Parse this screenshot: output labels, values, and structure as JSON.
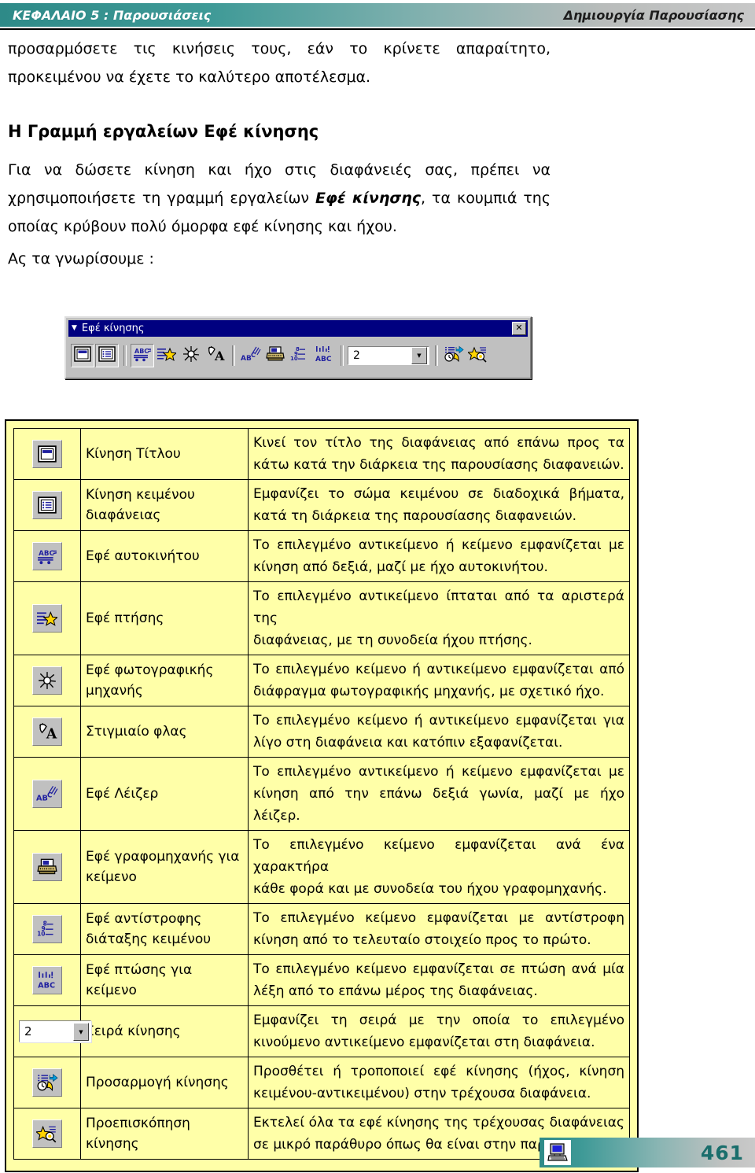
{
  "header": {
    "chapter": "ΚΕΦΑΛΑΙΟ 5 :  Παρουσιάσεις",
    "section": "Δημιουργία Παρουσίασης"
  },
  "content": {
    "intro_paragraph": "προσαρμόσετε τις κινήσεις τους, εάν το κρίνετε απαραίτητο, προκειμένου να έχετε το καλύτερο αποτέλεσμα.",
    "section_heading": "Η Γραμμή εργαλείων Εφέ κίνησης",
    "body_part1": "Για να δώσετε κίνηση και ήχο στις διαφάνειές σας, πρέπει να χρησιμοποιήσετε τη γραμμή εργαλείων ",
    "body_emphasis": "Εφέ κίνησης",
    "body_part2": ", τα κουμπιά της οποίας κρύβουν πολύ όμορφα εφέ κίνησης και ήχου.",
    "lets_know": "Ας τα γνωρίσουμε :"
  },
  "toolbar": {
    "title": "Εφέ κίνησης",
    "close_label": "✕",
    "drop_arrow": "▼",
    "order_value": "2",
    "buttons": [
      {
        "name": "animate-title-button",
        "icon": "window-title-icon"
      },
      {
        "name": "animate-slide-text-button",
        "icon": "window-list-icon"
      },
      {
        "name": "drive-in-effect-button",
        "icon": "abc-car-icon"
      },
      {
        "name": "flying-effect-button",
        "icon": "lines-star-icon"
      },
      {
        "name": "camera-effect-button",
        "icon": "camera-burst-icon"
      },
      {
        "name": "flash-once-button",
        "icon": "flash-a-icon"
      },
      {
        "name": "laser-text-effect-button",
        "icon": "ab-laser-icon"
      },
      {
        "name": "typewriter-text-effect-button",
        "icon": "typewriter-icon"
      },
      {
        "name": "reverse-text-order-effect-button",
        "icon": "numbers-reverse-icon"
      },
      {
        "name": "drop-in-text-effect-button",
        "icon": "abc-drop-icon"
      },
      {
        "name": "animation-order-combo",
        "icon": "combo-box"
      },
      {
        "name": "custom-animation-button",
        "icon": "custom-animation-icon"
      },
      {
        "name": "animation-preview-button",
        "icon": "star-preview-icon"
      }
    ]
  },
  "table": {
    "rows": [
      {
        "icon": "window-title-icon",
        "name": "Κίνηση Τίτλου",
        "desc_lines": [
          "Κινεί τον τίτλο της διαφάνειας από επάνω προς τα",
          "κάτω κατά την διάρκεια της παρουσίασης διαφανειών."
        ]
      },
      {
        "icon": "window-list-icon",
        "name": "Κίνηση κειμένου διαφάνειας",
        "desc_lines": [
          "Εμφανίζει το σώμα κειμένου σε διαδοχικά βήματα,",
          "κατά τη διάρκεια της παρουσίασης διαφανειών."
        ]
      },
      {
        "icon": "abc-car-icon",
        "name": "Εφέ αυτοκινήτου",
        "desc_lines": [
          "Το επιλεγμένο αντικείμενο ή κείμενο εμφανίζεται με",
          "κίνηση από δεξιά, μαζί με ήχο αυτοκινήτου."
        ]
      },
      {
        "icon": "lines-star-icon",
        "name": "Εφέ πτήσης",
        "desc_lines": [
          "Το επιλεγμένο αντικείμενο ίπταται από τα αριστερά της",
          "διαφάνειας, με τη συνοδεία ήχου πτήσης."
        ]
      },
      {
        "icon": "camera-burst-icon",
        "name": "Εφέ φωτογραφικής μηχανής",
        "desc_lines": [
          "Το επιλεγμένο κείμενο ή αντικείμενο εμφανίζεται από",
          "διάφραγμα φωτογραφικής μηχανής, με σχετικό ήχο."
        ]
      },
      {
        "icon": "flash-a-icon",
        "name": "Στιγμιαίο φλας",
        "desc_lines": [
          "Το επιλεγμένο κείμενο ή αντικείμενο εμφανίζεται για",
          "λίγο στη διαφάνεια και κατόπιν εξαφανίζεται."
        ]
      },
      {
        "icon": "ab-laser-icon",
        "name": "Εφέ Λέιζερ",
        "desc_lines": [
          "Το επιλεγμένο αντικείμενο ή κείμενο εμφανίζεται με",
          "κίνηση από την επάνω δεξιά γωνία, μαζί με ήχο λέιζερ."
        ]
      },
      {
        "icon": "typewriter-icon",
        "name": "Εφέ γραφομηχανής για κείμενο",
        "desc_lines": [
          "Το επιλεγμένο κείμενο εμφανίζεται ανά ένα χαρακτήρα",
          "κάθε φορά και με συνοδεία του ήχου γραφομηχανής."
        ]
      },
      {
        "icon": "numbers-reverse-icon",
        "name": "Εφέ αντίστροφης διάταξης κειμένου",
        "desc_lines": [
          "Το επιλεγμένο κείμενο εμφανίζεται με αντίστροφη",
          "κίνηση από το τελευταίο στοιχείο προς το πρώτο."
        ]
      },
      {
        "icon": "abc-drop-icon",
        "name": "Εφέ πτώσης για κείμενο",
        "desc_lines": [
          "Το επιλεγμένο κείμενο εμφανίζεται σε πτώση ανά μία",
          "λέξη από το επάνω μέρος της διαφάνειας."
        ]
      },
      {
        "icon": "combo-box",
        "name": "Σειρά κίνησης",
        "desc_lines": [
          "Εμφανίζει τη σειρά με την οποία το επιλεγμένο",
          "κινούμενο αντικείμενο εμφανίζεται στη διαφάνεια."
        ]
      },
      {
        "icon": "custom-animation-icon",
        "name": "Προσαρμογή κίνησης",
        "desc_lines": [
          "Προσθέτει ή τροποποιεί εφέ κίνησης (ήχος, κίνηση",
          "κειμένου-αντικειμένου) στην τρέχουσα διαφάνεια."
        ]
      },
      {
        "icon": "star-preview-icon",
        "name": "Προεπισκόπηση κίνησης",
        "desc_lines": [
          "Εκτελεί όλα τα εφέ κίνησης της τρέχουσας διαφάνειας",
          "σε μικρό παράθυρο όπως θα είναι στην παρουσίαση."
        ]
      }
    ]
  },
  "footer": {
    "page_number": "461",
    "icon": "computer-icon"
  },
  "colors": {
    "header_teal": "#2e8a88",
    "table_yellow": "#ffffa8",
    "titlebar_blue": "#000080",
    "page_number_color": "#1a6e6c"
  }
}
